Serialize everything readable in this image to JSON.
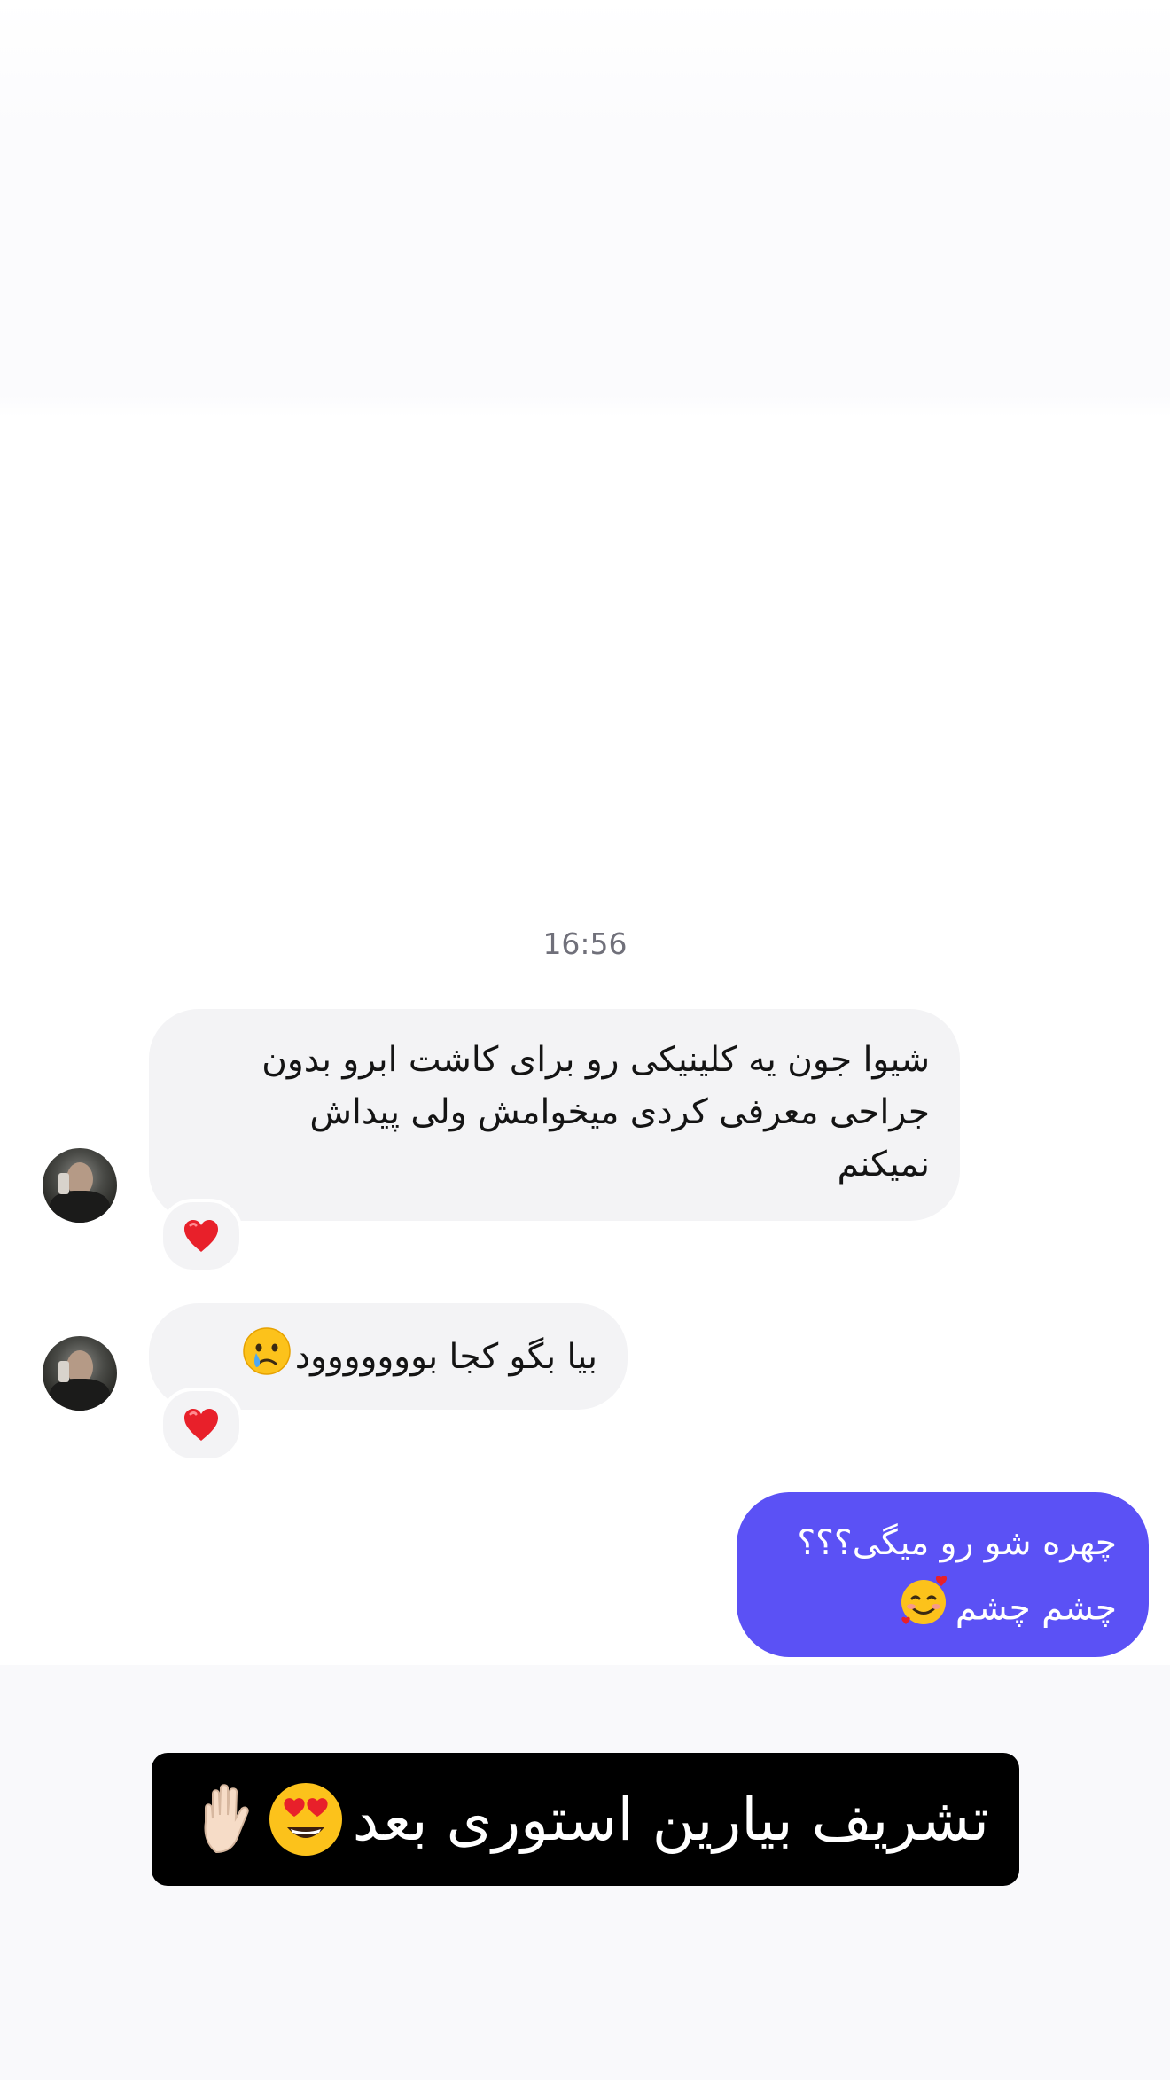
{
  "timestamp": "16:56",
  "messages": [
    {
      "direction": "incoming",
      "lines": [
        "شیوا جون یه کلینیکی رو برای کاشت ابرو بدون",
        "جراحی معرفی کردی میخوامش ولی پیداش",
        "نمیکنم"
      ],
      "reaction": "heart-emoji"
    },
    {
      "direction": "incoming",
      "text": "بیا بگو کجا بووووووود",
      "emoji": "crying-face-emoji",
      "reaction": "heart-emoji"
    },
    {
      "direction": "outgoing",
      "line1": "چهره شو رو میگی؟؟؟",
      "line2": "چشم چشم",
      "emoji": "smiling-face-with-hearts-emoji"
    }
  ],
  "story_banner": {
    "text": "تشریف بیارین استوری بعد",
    "emojis": [
      "heart-eyes-emoji",
      "raised-hand-emoji"
    ]
  },
  "colors": {
    "outgoing_bubble": "#5b51f5",
    "incoming_bubble": "#f3f3f5",
    "banner": "#000000"
  }
}
